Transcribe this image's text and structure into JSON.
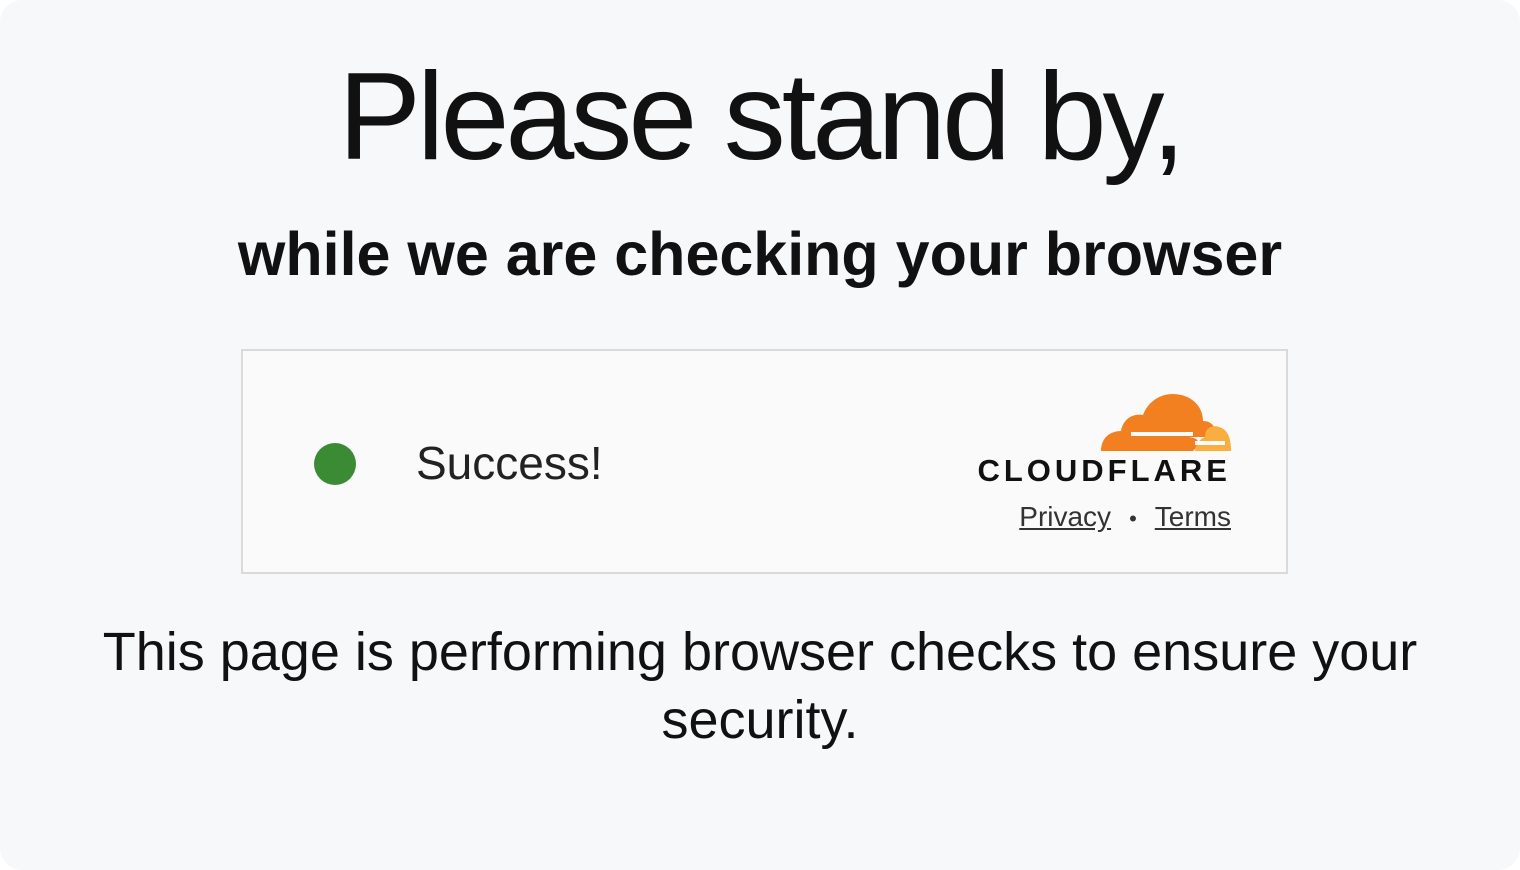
{
  "headline": "Please stand by,",
  "subheadline": "while we are checking your browser",
  "widget": {
    "status_text": "Success!",
    "status_color": "#3a8b33",
    "brand": "CLOUDFLARE",
    "brand_colors": {
      "cloud_primary": "#f38020",
      "cloud_secondary": "#faae40"
    },
    "links": {
      "privacy": "Privacy",
      "separator": "•",
      "terms": "Terms"
    }
  },
  "footer_text": "This page is performing browser checks to ensure your security."
}
